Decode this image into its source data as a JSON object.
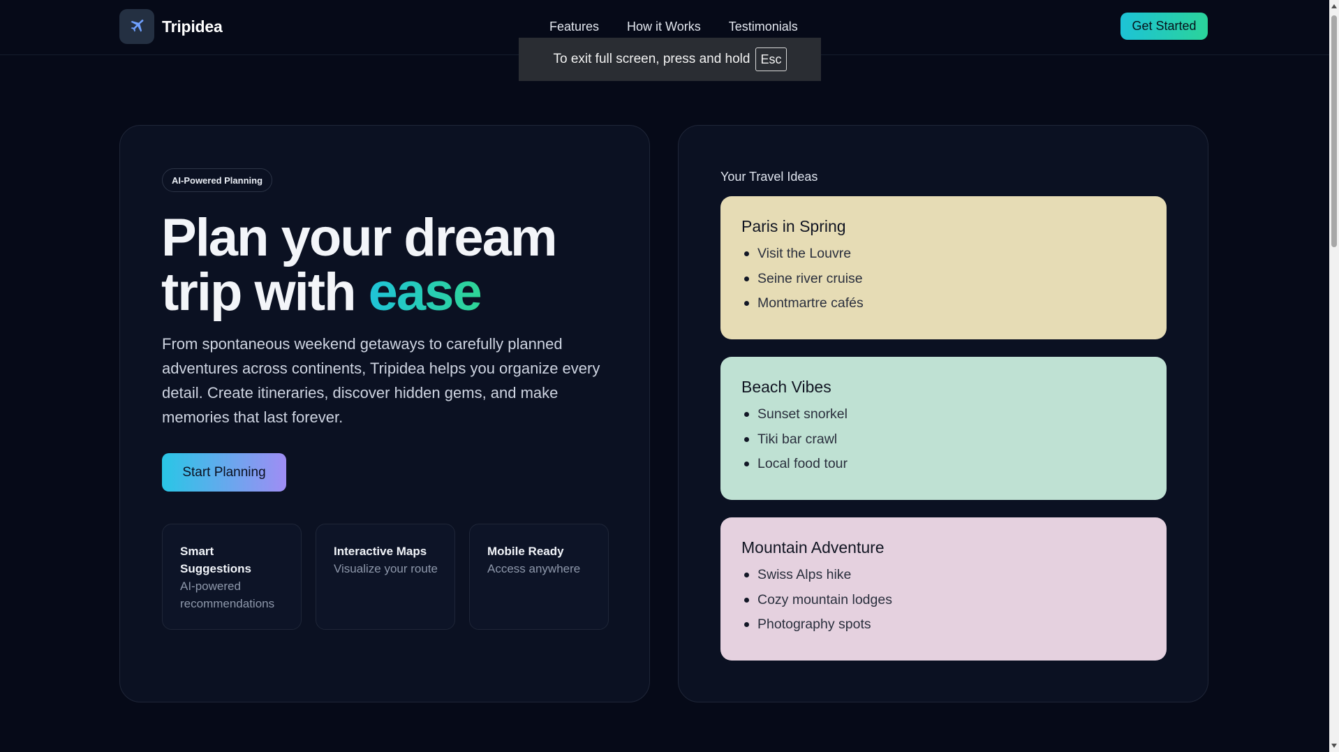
{
  "header": {
    "brand": "Tripidea",
    "logo_icon": "airplane-icon",
    "nav": [
      {
        "label": "Features"
      },
      {
        "label": "How it Works"
      },
      {
        "label": "Testimonials"
      }
    ],
    "cta_label": "Get Started"
  },
  "fullscreen_notice": {
    "text": "To exit full screen, press and hold",
    "key": "Esc"
  },
  "hero": {
    "badge": "AI-Powered Planning",
    "headline_main": "Plan your dream trip with",
    "headline_accent": "ease",
    "description": "From spontaneous weekend getaways to carefully planned adventures across continents, Tripidea helps you organize every detail. Create itineraries, discover hidden gems, and make memories that last forever.",
    "start_button": "Start Planning",
    "features": [
      {
        "title": "Smart Suggestions",
        "desc": "AI-powered recommendations"
      },
      {
        "title": "Interactive Maps",
        "desc": "Visualize your route"
      },
      {
        "title": "Mobile Ready",
        "desc": "Access anywhere"
      }
    ]
  },
  "ideas": {
    "label": "Your Travel Ideas",
    "cards": [
      {
        "title": "Paris in Spring",
        "color": "#e6dcb5",
        "items": [
          "Visit the Louvre",
          "Seine river cruise",
          "Montmartre cafés"
        ]
      },
      {
        "title": "Beach Vibes",
        "color": "#bfe1d3",
        "items": [
          "Sunset snorkel",
          "Tiki bar crawl",
          "Local food tour"
        ]
      },
      {
        "title": "Mountain Adventure",
        "color": "#e5d1df",
        "items": [
          "Swiss Alps hike",
          "Cozy mountain lodges",
          "Photography spots"
        ]
      }
    ]
  },
  "colors": {
    "background": "#060a18",
    "accent_cyan": "#1fc3d8",
    "accent_green": "#2fd596",
    "accent_violet": "#9f8df4"
  }
}
